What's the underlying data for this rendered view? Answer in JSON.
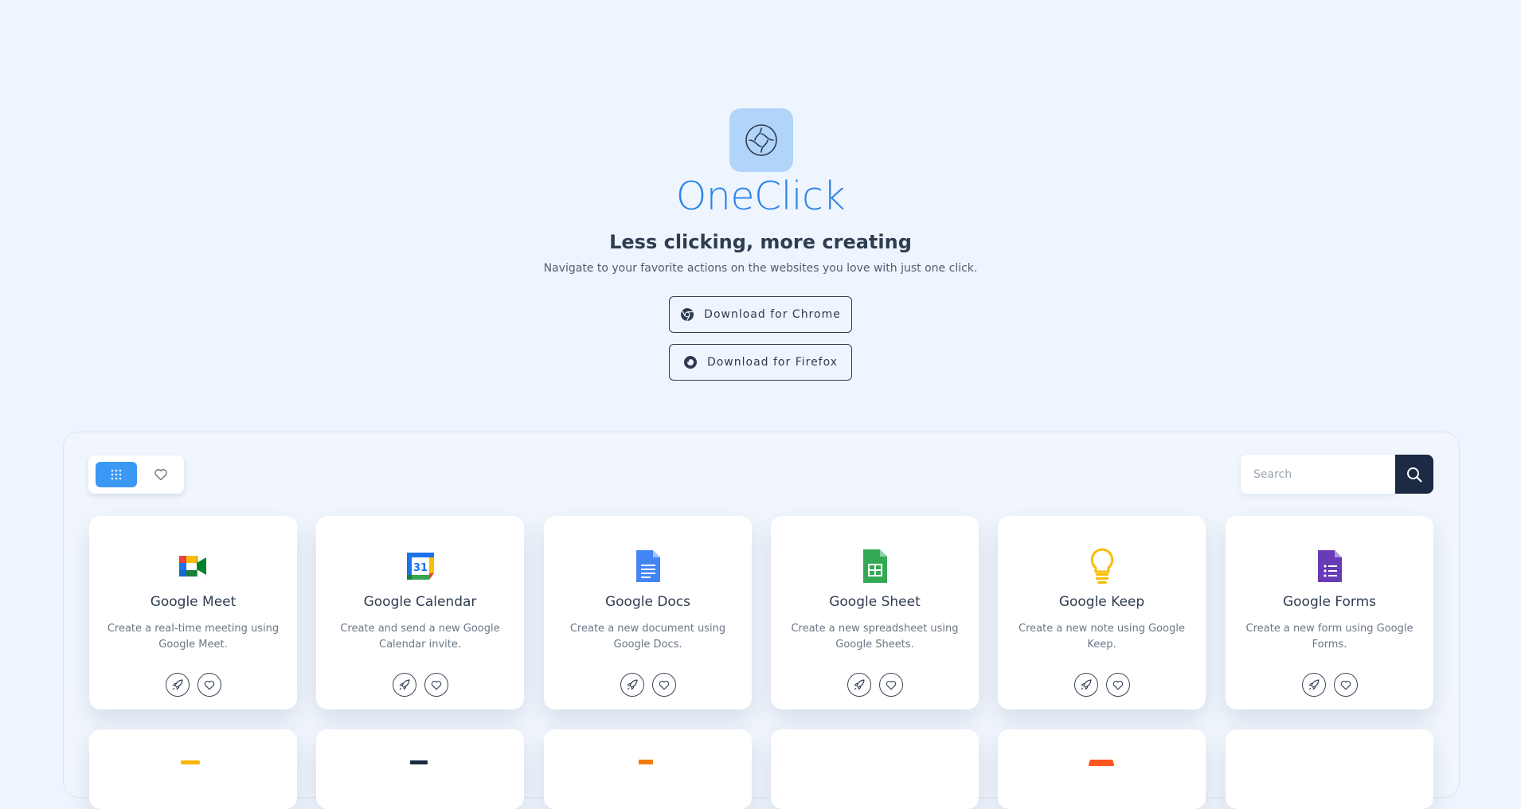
{
  "hero": {
    "app_name": "OneClick",
    "tagline": "Less clicking, more creating",
    "subtitle": "Navigate to your favorite actions on the websites you love with just one click.",
    "buttons": {
      "chrome": "Download for Chrome",
      "firefox": "Download for Firefox"
    }
  },
  "toolbar": {
    "view_all_icon": "grid-icon",
    "favorites_icon": "heart-icon",
    "search_placeholder": "Search",
    "search_icon": "search-icon"
  },
  "colors": {
    "background": "#eff5fe",
    "accent": "#3b98f5",
    "title": "#2b84e8",
    "dark": "#1c2a43"
  },
  "cards": [
    {
      "title": "Google Meet",
      "description": "Create a real-time meeting using Google Meet.",
      "icon": "google-meet-icon"
    },
    {
      "title": "Google Calendar",
      "description": "Create and send a new Google Calendar invite.",
      "icon": "google-calendar-icon"
    },
    {
      "title": "Google Docs",
      "description": "Create a new document using Google Docs.",
      "icon": "google-docs-icon"
    },
    {
      "title": "Google Sheet",
      "description": "Create a new spreadsheet using Google Sheets.",
      "icon": "google-sheets-icon"
    },
    {
      "title": "Google Keep",
      "description": "Create a new note using Google Keep.",
      "icon": "google-keep-icon"
    },
    {
      "title": "Google Forms",
      "description": "Create a new form using Google Forms.",
      "icon": "google-forms-icon"
    }
  ]
}
